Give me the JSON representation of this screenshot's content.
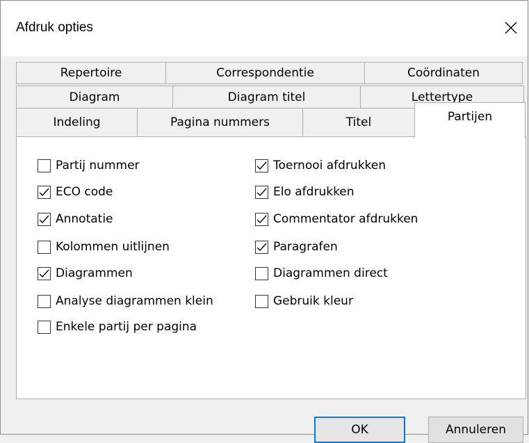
{
  "window": {
    "title": "Afdruk opties"
  },
  "tabs": {
    "row1": [
      "Repertoire",
      "Correspondentie",
      "Coördinaten"
    ],
    "row2": [
      "Diagram",
      "Diagram titel",
      "Lettertype"
    ],
    "row3": [
      "Indeling",
      "Pagina nummers",
      "Titel",
      "Partijen"
    ],
    "active": "Partijen"
  },
  "options": {
    "left": [
      {
        "label": "Partij nummer",
        "checked": false
      },
      {
        "label": "ECO code",
        "checked": true
      },
      {
        "label": "Annotatie",
        "checked": true
      },
      {
        "label": "Kolommen uitlijnen",
        "checked": false
      },
      {
        "label": "Diagrammen",
        "checked": true
      },
      {
        "label": "Analyse diagrammen klein",
        "checked": false
      },
      {
        "label": "Enkele partij per pagina",
        "checked": false
      }
    ],
    "right": [
      {
        "label": "Toernooi afdrukken",
        "checked": true
      },
      {
        "label": "Elo afdrukken",
        "checked": true
      },
      {
        "label": "Commentator afdrukken",
        "checked": true
      },
      {
        "label": "Paragrafen",
        "checked": true
      },
      {
        "label": "Diagrammen direct",
        "checked": false
      },
      {
        "label": "Gebruik kleur",
        "checked": false
      }
    ]
  },
  "buttons": {
    "ok": "OK",
    "cancel": "Annuleren"
  },
  "colors": {
    "accent": "#0078d7",
    "window_bg": "#f0f0f0",
    "panel_bg": "#ffffff"
  }
}
